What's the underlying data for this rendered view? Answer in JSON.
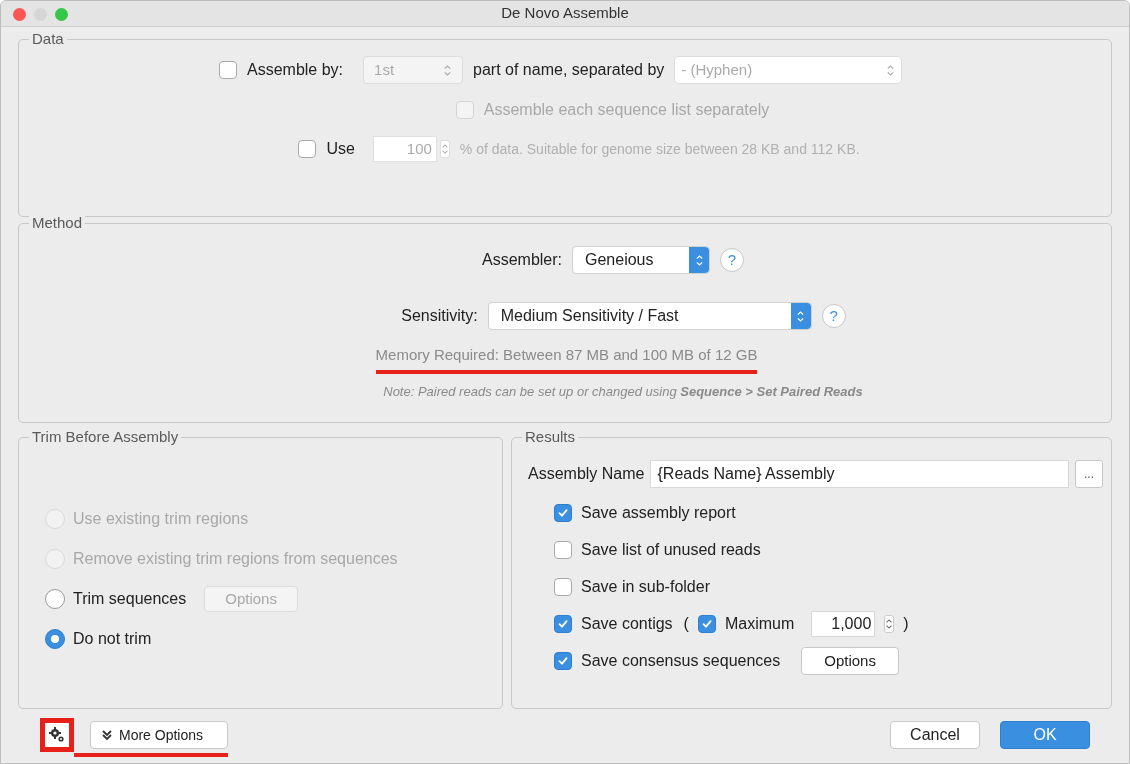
{
  "window": {
    "title": "De Novo Assemble"
  },
  "data": {
    "title": "Data",
    "assemble_by": {
      "checked": false,
      "label": "Assemble by:",
      "part": "1st",
      "middle": "part of name, separated by",
      "separator": "- (Hyphen)"
    },
    "each_list": {
      "checked": false,
      "disabled": true,
      "label": "Assemble each sequence list separately"
    },
    "use": {
      "checked": false,
      "label": "Use",
      "value": "100",
      "suffix": "% of data. Suitable for genome size between 28 KB and 112 KB."
    }
  },
  "method": {
    "title": "Method",
    "assembler": {
      "label": "Assembler:",
      "value": "Geneious",
      "help": "?"
    },
    "sensitivity": {
      "label": "Sensitivity:",
      "value": "Medium Sensitivity / Fast",
      "help": "?"
    },
    "memory": {
      "text": "Memory Required: Between 87 MB and 100 MB of 12 GB",
      "underlined": true
    },
    "note": "Note: Paired reads can be set up or changed using **Sequence > Set Paired Reads**"
  },
  "trim": {
    "title": "Trim Before Assembly",
    "options": [
      {
        "label": "Use existing trim regions",
        "selected": false,
        "disabled": true
      },
      {
        "label": "Remove existing trim regions from sequences",
        "selected": false,
        "disabled": true
      },
      {
        "label": "Trim sequences",
        "selected": false,
        "disabled": false,
        "button": {
          "label": "Options",
          "disabled": true
        }
      },
      {
        "label": "Do not trim",
        "selected": true,
        "disabled": false
      }
    ]
  },
  "results": {
    "title": "Results",
    "name_label": "Assembly Name",
    "name_value": "{Reads Name} Assembly",
    "browse": "...",
    "options": [
      {
        "kind": "plain",
        "label": "Save assembly report",
        "checked": true
      },
      {
        "kind": "plain",
        "label": "Save list of unused reads",
        "checked": false
      },
      {
        "kind": "plain",
        "label": "Save in sub-folder",
        "checked": false
      },
      {
        "kind": "limit",
        "label": "Save contigs",
        "checked": true,
        "open": "(",
        "limit_label": "Maximum",
        "limit_checked": true,
        "limit_value": "1,000",
        "close": ")"
      },
      {
        "kind": "button",
        "label": "Save consensus sequences",
        "checked": true,
        "button": "Options"
      }
    ]
  },
  "footer": {
    "settings_highlighted": true,
    "more_options": {
      "label": "More Options",
      "underlined": true
    },
    "cancel": "Cancel",
    "ok": "OK"
  }
}
